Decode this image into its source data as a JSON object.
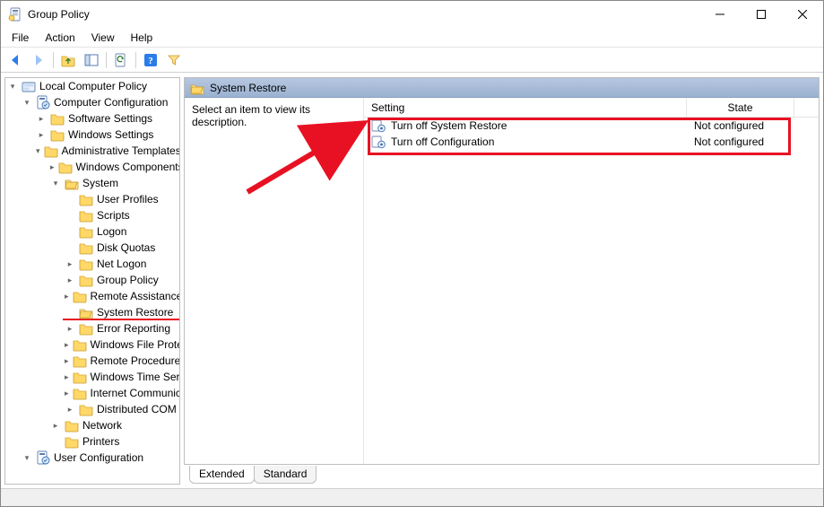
{
  "window": {
    "title": "Group Policy"
  },
  "menubar": [
    "File",
    "Action",
    "View",
    "Help"
  ],
  "tree": {
    "root": "Local Computer Policy",
    "computer_config": "Computer Configuration",
    "software_settings": "Software Settings",
    "windows_settings": "Windows Settings",
    "admin_templates": "Administrative Templates",
    "windows_components": "Windows Components",
    "system": "System",
    "system_children": [
      "User Profiles",
      "Scripts",
      "Logon",
      "Disk Quotas",
      "Net Logon",
      "Group Policy",
      "Remote Assistance",
      "System Restore",
      "Error Reporting",
      "Windows File Protection",
      "Remote Procedure Call",
      "Windows Time Service",
      "Internet Communication Management",
      "Distributed COM"
    ],
    "network": "Network",
    "printers": "Printers",
    "user_config": "User Configuration"
  },
  "detail": {
    "header": "System Restore",
    "description_prompt": "Select an item to view its description.",
    "columns": {
      "setting": "Setting",
      "state": "State"
    },
    "rows": [
      {
        "setting": "Turn off System Restore",
        "state": "Not configured"
      },
      {
        "setting": "Turn off Configuration",
        "state": "Not configured"
      }
    ]
  },
  "tabs": {
    "extended": "Extended",
    "standard": "Standard",
    "active": "extended"
  }
}
